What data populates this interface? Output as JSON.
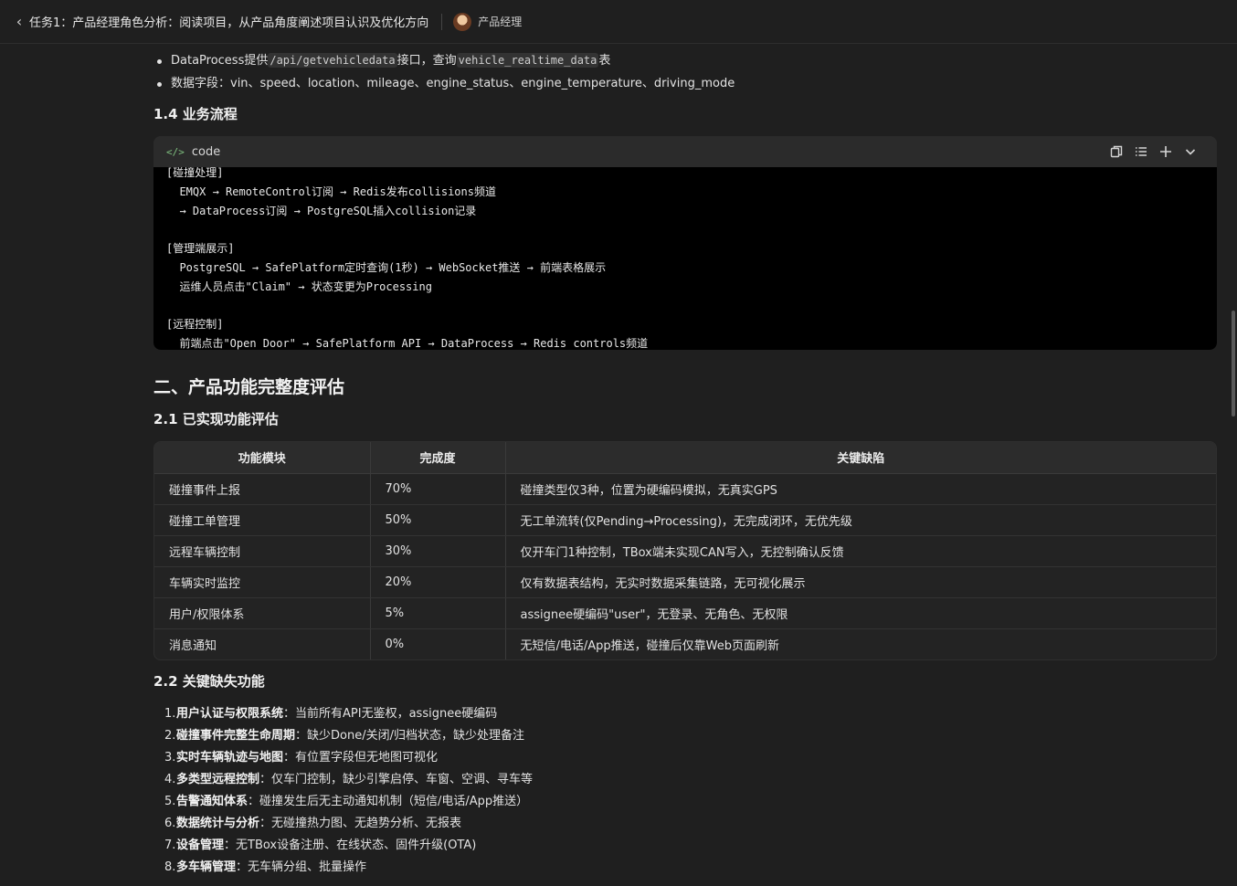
{
  "header": {
    "back_glyph": "‹",
    "task_title": "任务1：产品经理角色分析：阅读项目，从产品角度阐述项目认识及优化方向",
    "role_name": "产品经理"
  },
  "bullets": [
    {
      "prefix": "DataProcess提供",
      "code1": "/api/getvehicledata",
      "mid": "接口，查询",
      "code2": "vehicle_realtime_data",
      "suffix": "表"
    },
    {
      "text": "数据字段：vin、speed、location、mileage、engine_status、engine_temperature、driving_mode"
    }
  ],
  "section_1_4": {
    "title": "1.4 业务流程"
  },
  "code_block": {
    "lang": "code",
    "lines": [
      "[碰撞处理]",
      "  EMQX → RemoteControl订阅 → Redis发布collisions频道",
      "  → DataProcess订阅 → PostgreSQL插入collision记录",
      "",
      "[管理端展示]",
      "  PostgreSQL → SafePlatform定时查询(1秒) → WebSocket推送 → 前端表格展示",
      "  运维人员点击\"Claim\" → 状态变更为Processing",
      "",
      "[远程控制]",
      "  前端点击\"Open Door\" → SafePlatform API → DataProcess → Redis controls频道"
    ]
  },
  "section_2": {
    "title": "二、产品功能完整度评估"
  },
  "section_2_1": {
    "title": "2.1 已实现功能评估"
  },
  "table": {
    "headers": [
      "功能模块",
      "完成度",
      "关键缺陷"
    ],
    "rows": [
      [
        "碰撞事件上报",
        "70%",
        "碰撞类型仅3种，位置为硬编码模拟，无真实GPS"
      ],
      [
        "碰撞工单管理",
        "50%",
        "无工单流转(仅Pending→Processing)，无完成闭环，无优先级"
      ],
      [
        "远程车辆控制",
        "30%",
        "仅开车门1种控制，TBox端未实现CAN写入，无控制确认反馈"
      ],
      [
        "车辆实时监控",
        "20%",
        "仅有数据表结构，无实时数据采集链路，无可视化展示"
      ],
      [
        "用户/权限体系",
        "5%",
        "assignee硬编码\"user\"，无登录、无角色、无权限"
      ],
      [
        "消息通知",
        "0%",
        "无短信/电话/App推送，碰撞后仅靠Web页面刷新"
      ]
    ]
  },
  "section_2_2": {
    "title": "2.2 关键缺失功能"
  },
  "missing_features": [
    {
      "num": "1.",
      "bold": "用户认证与权限系统",
      "text": "：当前所有API无鉴权，assignee硬编码"
    },
    {
      "num": "2.",
      "bold": "碰撞事件完整生命周期",
      "text": "：缺少Done/关闭/归档状态，缺少处理备注"
    },
    {
      "num": "3.",
      "bold": "实时车辆轨迹与地图",
      "text": "：有位置字段但无地图可视化"
    },
    {
      "num": "4.",
      "bold": "多类型远程控制",
      "text": "：仅车门控制，缺少引擎启停、车窗、空调、寻车等"
    },
    {
      "num": "5.",
      "bold": "告警通知体系",
      "text": "：碰撞发生后无主动通知机制（短信/电话/App推送）"
    },
    {
      "num": "6.",
      "bold": "数据统计与分析",
      "text": "：无碰撞热力图、无趋势分析、无报表"
    },
    {
      "num": "7.",
      "bold": "设备管理",
      "text": "：无TBox设备注册、在线状态、固件升级(OTA)"
    },
    {
      "num": "8.",
      "bold": "多车辆管理",
      "text": "：无车辆分组、批量操作"
    }
  ]
}
